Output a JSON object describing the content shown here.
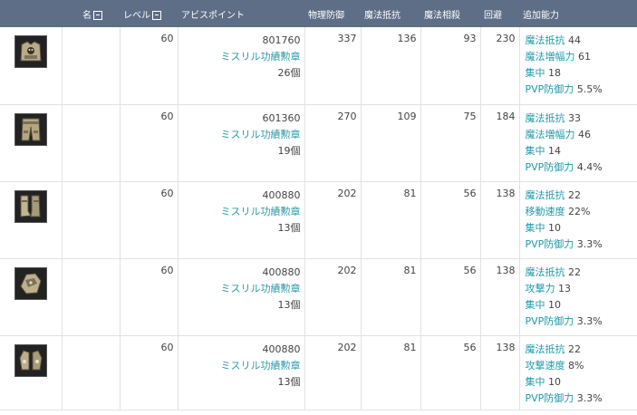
{
  "headers": {
    "name": "名",
    "level": "レベル",
    "ap": "アビスポイント",
    "phys_def": "物理防御",
    "magic_resist": "魔法抵抗",
    "magic_offset": "魔法相殺",
    "evasion": "回避",
    "bonus": "追加能力"
  },
  "items": [
    {
      "icon": "armor-chest-icon",
      "level": "60",
      "ap": "801760",
      "medal_name": "ミスリル功績勲章",
      "medal_count": "26個",
      "phys_def": "337",
      "magic_resist": "136",
      "magic_offset": "93",
      "evasion": "230",
      "bonus": [
        {
          "k": "魔法抵抗",
          "v": "44"
        },
        {
          "k": "魔法増幅力",
          "v": "61"
        },
        {
          "k": "集中",
          "v": "18"
        },
        {
          "k": "PVP防御力",
          "v": "5.5%"
        }
      ]
    },
    {
      "icon": "armor-legs-icon",
      "level": "60",
      "ap": "601360",
      "medal_name": "ミスリル功績勲章",
      "medal_count": "19個",
      "phys_def": "270",
      "magic_resist": "109",
      "magic_offset": "75",
      "evasion": "184",
      "bonus": [
        {
          "k": "魔法抵抗",
          "v": "33"
        },
        {
          "k": "魔法増幅力",
          "v": "46"
        },
        {
          "k": "集中",
          "v": "14"
        },
        {
          "k": "PVP防御力",
          "v": "4.4%"
        }
      ]
    },
    {
      "icon": "armor-boots-icon",
      "level": "60",
      "ap": "400880",
      "medal_name": "ミスリル功績勲章",
      "medal_count": "13個",
      "phys_def": "202",
      "magic_resist": "81",
      "magic_offset": "56",
      "evasion": "138",
      "bonus": [
        {
          "k": "魔法抵抗",
          "v": "22"
        },
        {
          "k": "移動速度",
          "v": "22%"
        },
        {
          "k": "集中",
          "v": "10"
        },
        {
          "k": "PVP防御力",
          "v": "3.3%"
        }
      ]
    },
    {
      "icon": "armor-shoulder-icon",
      "level": "60",
      "ap": "400880",
      "medal_name": "ミスリル功績勲章",
      "medal_count": "13個",
      "phys_def": "202",
      "magic_resist": "81",
      "magic_offset": "56",
      "evasion": "138",
      "bonus": [
        {
          "k": "魔法抵抗",
          "v": "22"
        },
        {
          "k": "攻撃力",
          "v": "13"
        },
        {
          "k": "集中",
          "v": "10"
        },
        {
          "k": "PVP防御力",
          "v": "3.3%"
        }
      ]
    },
    {
      "icon": "armor-gloves-icon",
      "level": "60",
      "ap": "400880",
      "medal_name": "ミスリル功績勲章",
      "medal_count": "13個",
      "phys_def": "202",
      "magic_resist": "81",
      "magic_offset": "56",
      "evasion": "138",
      "bonus": [
        {
          "k": "魔法抵抗",
          "v": "22"
        },
        {
          "k": "攻撃速度",
          "v": "8%"
        },
        {
          "k": "集中",
          "v": "10"
        },
        {
          "k": "PVP防御力",
          "v": "3.3%"
        }
      ]
    }
  ]
}
